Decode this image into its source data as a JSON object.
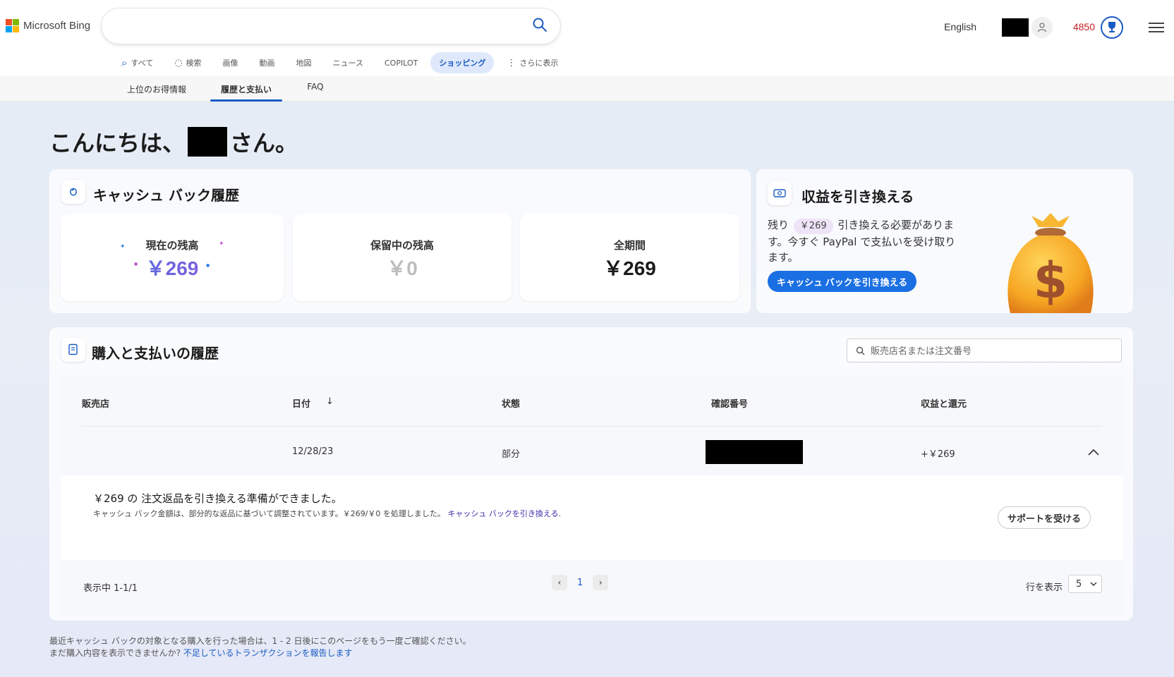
{
  "header": {
    "brand": "Microsoft Bing",
    "search_value": "",
    "language": "English",
    "points": "4850"
  },
  "nav": [
    {
      "label": "すべて",
      "icon": "search-icon"
    },
    {
      "label": "検索",
      "icon": "copilot-icon"
    },
    {
      "label": "画像",
      "icon": ""
    },
    {
      "label": "動画",
      "icon": ""
    },
    {
      "label": "地図",
      "icon": ""
    },
    {
      "label": "ニュース",
      "icon": ""
    },
    {
      "label": "COPILOT",
      "icon": ""
    },
    {
      "label": "ショッピング",
      "icon": "",
      "active": true
    },
    {
      "label": "さらに表示",
      "icon": "more-vertical-icon"
    }
  ],
  "subnav": [
    {
      "label": "上位のお得情報"
    },
    {
      "label": "履歴と支払い",
      "active": true
    },
    {
      "label": "FAQ"
    }
  ],
  "greeting": {
    "prefix": "こんにちは、",
    "suffix": "さん。"
  },
  "cashback": {
    "title": "キャッシュ バック履歴",
    "current": {
      "label": "現在の残高",
      "value": "￥269"
    },
    "pending": {
      "label": "保留中の残高",
      "value": "￥0"
    },
    "lifetime": {
      "label": "全期間",
      "value": "￥269"
    }
  },
  "redeem": {
    "title": "収益を引き換える",
    "text_before": "残り",
    "amount": "￥269",
    "text_after": "引き換える必要がありま す。今すぐ PayPal で支払いを受け取り ます。",
    "button": "キャッシュ バックを引き換える"
  },
  "history": {
    "title": "購入と支払いの履歴",
    "search_placeholder": "販売店名または注文番号",
    "columns": [
      "販売店",
      "日付",
      "状態",
      "確認番号",
      "収益と還元"
    ],
    "sort_arrow": "↓",
    "rows": [
      {
        "merchant": "",
        "date": "12/28/23",
        "status": "部分",
        "confirmation": "",
        "earnings": "+￥269"
      }
    ],
    "detail": {
      "title": "￥269 の 注文返品を引き換える準備ができました。",
      "desc": "キャッシュ バック金額は、部分的な返品に基づいて調整されています。￥269/￥0 を処理しました。",
      "link": "キャッシュ バックを引き換える",
      "link_suffix": ".",
      "support_button": "サポートを受ける"
    },
    "showing": "表示中 1-1/1",
    "page": "1",
    "prev": "‹",
    "next": "›",
    "rows_label": "行を表示",
    "rows_value": "5"
  },
  "footer": {
    "line1": "最近キャッシュ バックの対象となる購入を行った場合は、1 - 2 日後にこのページをもう一度ご確認ください。",
    "line2_prefix": "まだ購入内容を表示できませんか?",
    "line2_link": "不足しているトランザクションを報告します"
  },
  "colors": {
    "accent": "#1a6fe3",
    "points_red": "#c11f1f",
    "current_balance_gradient": [
      "#2f7be8",
      "#b04fd6"
    ]
  }
}
